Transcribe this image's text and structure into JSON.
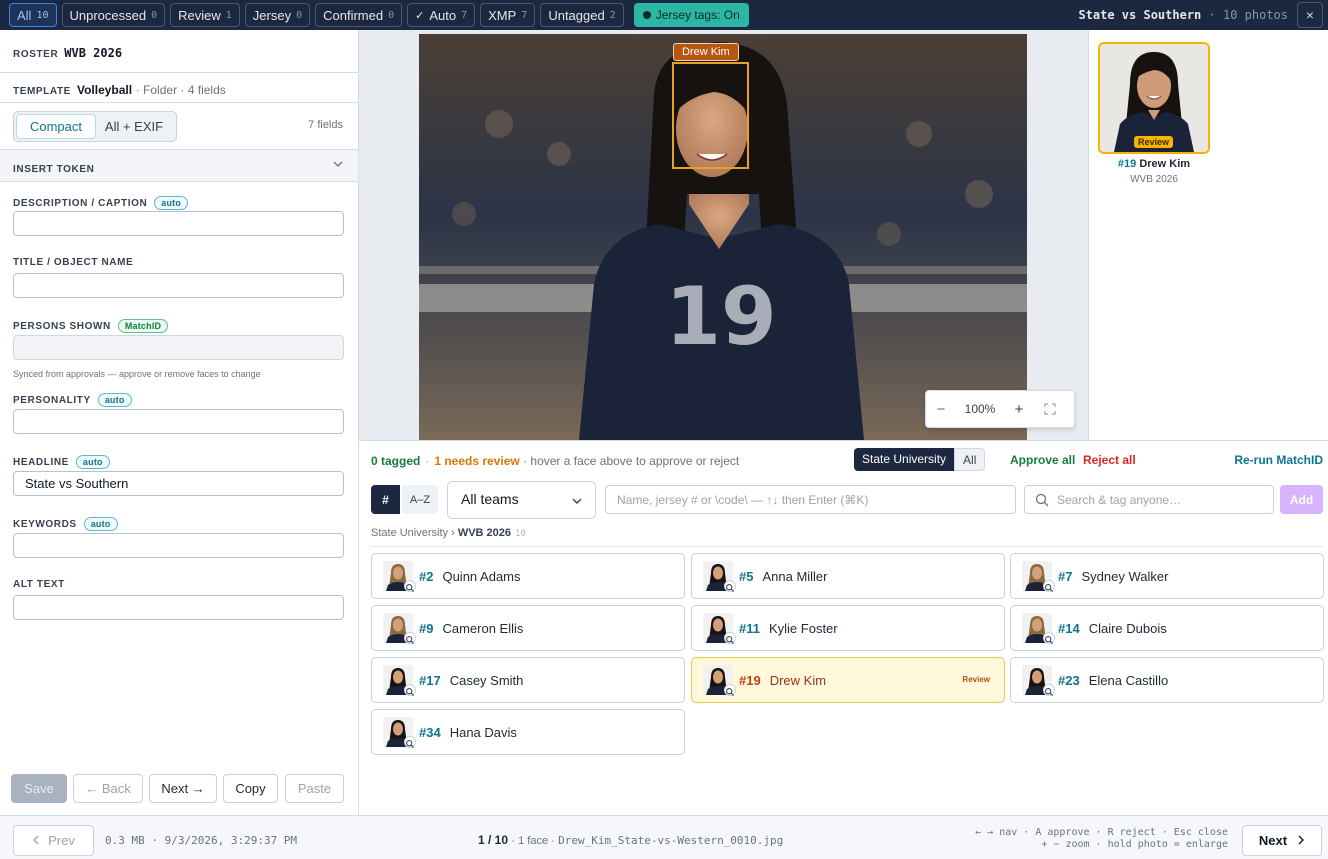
{
  "filters": [
    {
      "label": "All",
      "count": "10",
      "active": true
    },
    {
      "label": "Unprocessed",
      "count": "0"
    },
    {
      "label": "Review",
      "count": "1"
    },
    {
      "label": "Jersey",
      "count": "0"
    },
    {
      "label": "Confirmed",
      "count": "0"
    },
    {
      "label": "Auto",
      "count": "7"
    },
    {
      "label": "XMP",
      "count": "7"
    },
    {
      "label": "Untagged",
      "count": "2"
    }
  ],
  "jersey_tags": "Jersey tags: On",
  "event": {
    "title": "State vs Southern",
    "sub": "· 10 photos"
  },
  "close_icon": "×",
  "left": {
    "roster_label": "ROSTER",
    "roster_value": "WVB 2026",
    "template_label": "TEMPLATE",
    "template_value": "Volleyball",
    "template_meta": "· Folder · 4 fields",
    "seg_compact": "Compact",
    "seg_exif": "All + EXIF",
    "field_count": "7 fields",
    "insert_token": "INSERT TOKEN",
    "chevron": "⌄",
    "fields": [
      {
        "label": "DESCRIPTION / CAPTION",
        "badge": "auto",
        "value": ""
      },
      {
        "label": "TITLE / OBJECT NAME",
        "badge": "",
        "value": ""
      },
      {
        "label": "PERSONS SHOWN",
        "badge": "MatchID",
        "value": ""
      },
      {
        "label": "PERSONALITY",
        "badge": "auto",
        "value": ""
      },
      {
        "label": "HEADLINE",
        "badge": "auto",
        "value": "State vs Southern"
      },
      {
        "label": "KEYWORDS",
        "badge": "auto",
        "value": ""
      },
      {
        "label": "ALT TEXT",
        "badge": "",
        "value": ""
      }
    ],
    "helper": "Synced from approvals — approve or remove faces to change",
    "buttons": {
      "save": "Save",
      "back": "← Back",
      "next": "Next →",
      "copy": "Copy",
      "paste": "Paste"
    }
  },
  "photo": {
    "face_label": "Drew Kim",
    "jersey_number": "19",
    "zoom": "100%",
    "zoom_minus": "−",
    "zoom_plus": "+"
  },
  "rail": {
    "badge": "Review",
    "num": "#19",
    "name": "Drew Kim",
    "roster": "WVB 2026"
  },
  "bottom": {
    "tagged": "0 tagged",
    "sep": "·",
    "review": "1 needs review",
    "hint": "· hover a face above to approve or reject",
    "team_su": "State University",
    "team_all": "All",
    "approve_all": "Approve all",
    "reject_all": "Reject all",
    "rerun": "Re-run MatchID",
    "sort_num": "#",
    "sort_az": "A–Z",
    "team_select": "All teams",
    "quick_placeholder": "Name, jersey # or \\code\\ — ↑↓ then Enter (⌘K)",
    "search_placeholder": "Search & tag anyone…",
    "add": "Add",
    "crumb_team": "State University",
    "crumb_sep": "›",
    "crumb_roster": "WVB 2026",
    "crumb_count": "10",
    "players": [
      {
        "num": "#2",
        "name": "Quinn Adams",
        "tone": "light"
      },
      {
        "num": "#5",
        "name": "Anna Miller",
        "tone": "dark"
      },
      {
        "num": "#7",
        "name": "Sydney Walker",
        "tone": "light"
      },
      {
        "num": "#9",
        "name": "Cameron Ellis",
        "tone": "light"
      },
      {
        "num": "#11",
        "name": "Kylie Foster",
        "tone": "dark"
      },
      {
        "num": "#14",
        "name": "Claire Dubois",
        "tone": "light"
      },
      {
        "num": "#17",
        "name": "Casey Smith",
        "tone": "dark"
      },
      {
        "num": "#19",
        "name": "Drew Kim",
        "tone": "dark",
        "selected": true,
        "badge": "Review"
      },
      {
        "num": "#23",
        "name": "Elena Castillo",
        "tone": "dark"
      },
      {
        "num": "#34",
        "name": "Hana Davis",
        "tone": "dark"
      }
    ]
  },
  "footer": {
    "prev": "Prev",
    "file_meta": "0.3 MB · 9/3/2026, 3:29:37 PM",
    "position": "1 / 10",
    "faces": "· 1 face ·",
    "filename": "Drew_Kim_State-vs-Western_0010.jpg",
    "shortcuts_1": "← → nav · A approve · R reject · Esc close",
    "shortcuts_2": "+ − zoom · hold photo = enlarge",
    "next": "Next"
  },
  "colors": {
    "topbar": "#1c2740",
    "accent_teal": "#2bb6a6",
    "review": "#f5b400",
    "approve": "#15803d",
    "reject": "#dc2626"
  }
}
